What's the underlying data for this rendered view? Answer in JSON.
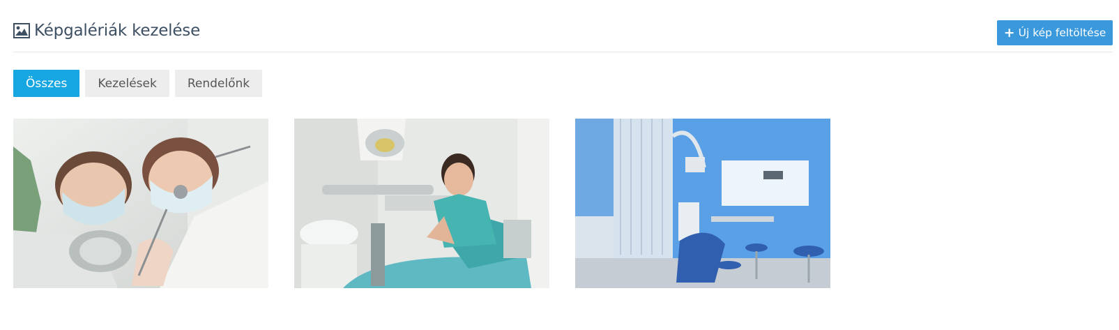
{
  "header": {
    "title": "Képgalériák kezelése",
    "title_icon": "image-icon",
    "upload_button": {
      "icon": "plus-icon",
      "label": "Új kép feltöltése"
    }
  },
  "filters": [
    {
      "label": "Összes",
      "active": true
    },
    {
      "label": "Kezelések",
      "active": false
    },
    {
      "label": "Rendelőnk",
      "active": false
    }
  ],
  "gallery": [
    {
      "subject": "two dentists looking down at the patient"
    },
    {
      "subject": "smiling dentist sitting by the dental chair"
    },
    {
      "subject": "blue dental treatment room"
    }
  ],
  "colors": {
    "primary": "#3a99dd",
    "filter_active": "#16a6e2",
    "filter_inactive": "#ededed"
  }
}
